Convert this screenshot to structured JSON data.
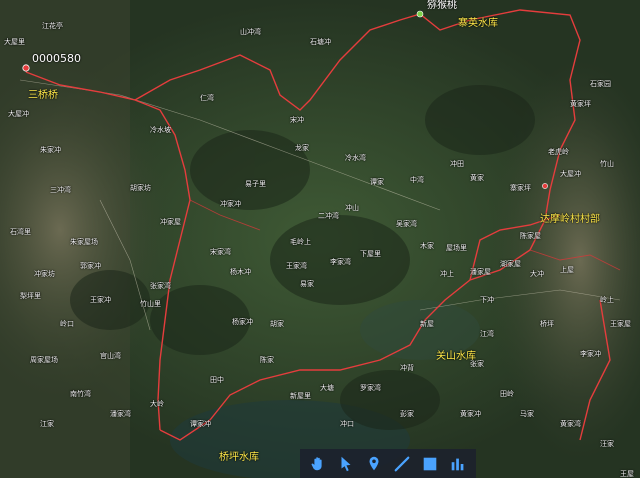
{
  "map": {
    "code_label": "0000580",
    "highlights": {
      "start": "三桥桥",
      "summit": "猕猴桃",
      "reservoir_ne": "寨英水库",
      "village": "达摩岭村村部",
      "reservoir_mid": "关山水库",
      "reservoir_sw": "桥坪水库"
    },
    "places": [
      "大屋里",
      "江花亭",
      "大屋冲",
      "朱家冲",
      "三冲湾",
      "石湾里",
      "朱家屋场",
      "郭家冲",
      "冲家坊",
      "梨坪里",
      "王家冲",
      "岭口",
      "周家屋场",
      "官山湾",
      "南竹湾",
      "江家",
      "潘家湾",
      "山冲湾",
      "石塘冲",
      "仁湾",
      "冷水坡",
      "易子里",
      "冲家冲",
      "胡家坊",
      "冲家屋",
      "竹山里",
      "张家湾",
      "宋家湾",
      "杨木冲",
      "宋冲",
      "龙家",
      "冷水湾",
      "谭家",
      "冲山",
      "二冲湾",
      "毛岭上",
      "王家湾",
      "李家湾",
      "易家",
      "下屋里",
      "中湾",
      "吴家湾",
      "木家",
      "屋场里",
      "冲上",
      "潘家屋",
      "湖家屋",
      "陈家屋",
      "冲田",
      "黄家",
      "寨家坪",
      "老虎岭",
      "大屋冲",
      "黄家坪",
      "石家园",
      "竹山",
      "上屋",
      "大冲",
      "桥坪",
      "下冲",
      "江湾",
      "张家",
      "田岭",
      "李家冲",
      "岭上",
      "王家屋",
      "新屋",
      "冲背",
      "罗家湾",
      "大塘",
      "新屋里",
      "陈家",
      "杨家冲",
      "胡家",
      "田中",
      "谭家冲",
      "大岭",
      "冲口",
      "彭家",
      "黄家冲",
      "马家",
      "黄家湾",
      "汪家",
      "王屋"
    ]
  },
  "toolbar": {
    "tools": [
      "hand-icon",
      "pointer-icon",
      "placemark-icon",
      "path-icon",
      "polygon-icon",
      "elevation-icon"
    ]
  }
}
